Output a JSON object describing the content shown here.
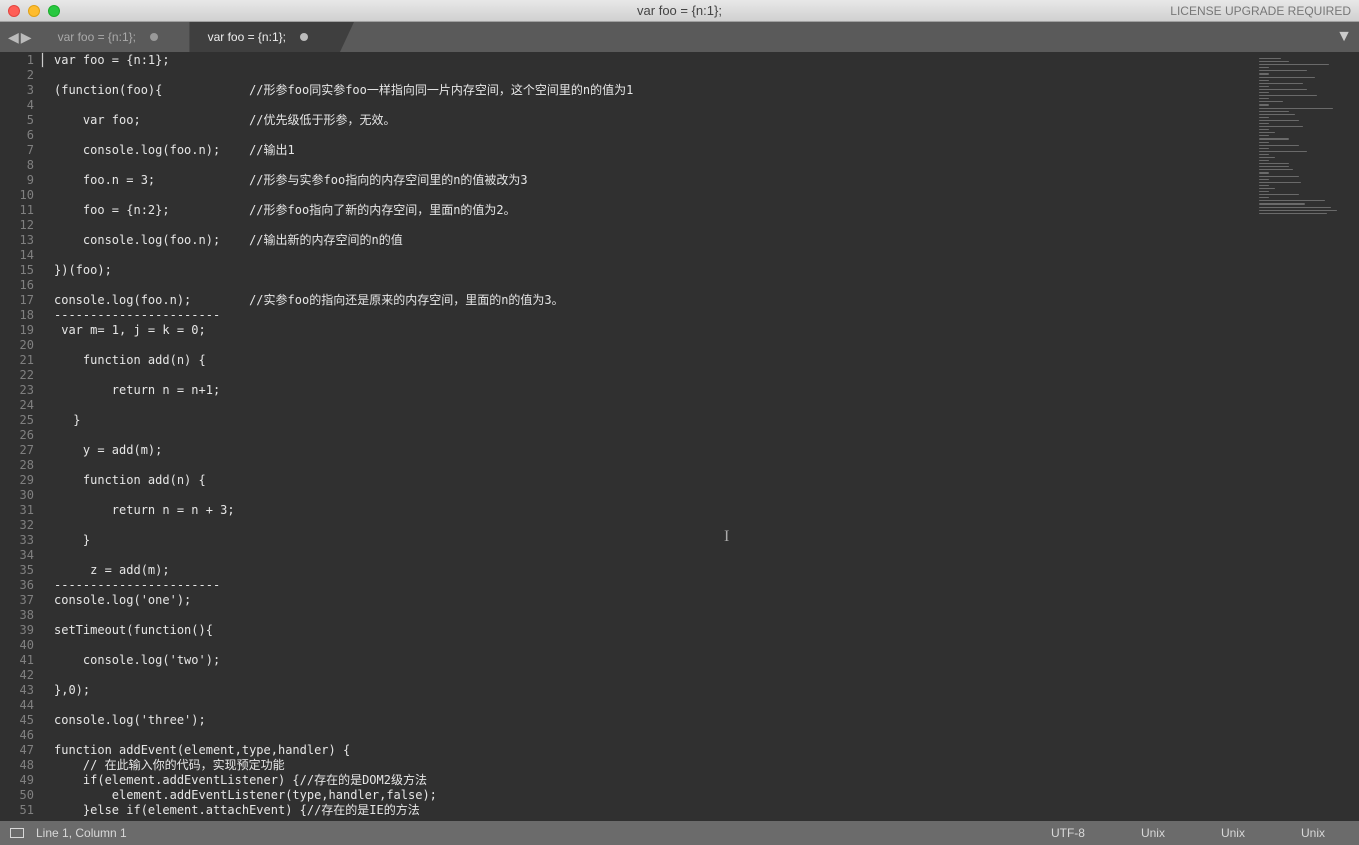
{
  "window": {
    "title": "var foo = {n:1};",
    "license_msg": "LICENSE UPGRADE REQUIRED"
  },
  "tabs": [
    {
      "label": "var foo = {n:1};",
      "active": false,
      "dirty": true
    },
    {
      "label": "var foo = {n:1};",
      "active": true,
      "dirty": true
    }
  ],
  "code_lines": [
    "var foo = {n:1};",
    "",
    "(function(foo){            //形参foo同实参foo一样指向同一片内存空间，这个空间里的n的值为1",
    "",
    "    var foo;               //优先级低于形参，无效。",
    "",
    "    console.log(foo.n);    //输出1",
    "",
    "    foo.n = 3;             //形参与实参foo指向的内存空间里的n的值被改为3",
    "",
    "    foo = {n:2};           //形参foo指向了新的内存空间，里面n的值为2。",
    "",
    "    console.log(foo.n);    //输出新的内存空间的n的值",
    "",
    "})(foo);",
    "",
    "console.log(foo.n);        //实参foo的指向还是原来的内存空间，里面的n的值为3。",
    "-----------------------",
    " var m= 1, j = k = 0;",
    "",
    "    function add(n) {",
    "",
    "        return n = n+1;",
    "",
    "　 }",
    "",
    "    y = add(m);",
    "",
    "    function add(n) {",
    "",
    "        return n = n + 3;",
    "",
    "    }",
    "",
    "     z = add(m);",
    "-----------------------",
    "console.log('one');",
    "",
    "setTimeout(function(){",
    "",
    "    console.log('two');",
    "",
    "},0);",
    "",
    "console.log('three');",
    "",
    "function addEvent(element,type,handler) {",
    "    // 在此输入你的代码，实现预定功能",
    "    if(element.addEventListener) {//存在的是DOM2级方法",
    "        element.addEventListener(type,handler,false);",
    "    }else if(element.attachEvent) {//存在的是IE的方法"
  ],
  "status": {
    "position": "Line 1, Column 1",
    "encoding": "UTF-8",
    "line_endings": "Unix",
    "extra1": "Unix",
    "extra2": "Unix"
  },
  "minimap_widths": [
    22,
    30,
    70,
    10,
    48,
    10,
    56,
    10,
    44,
    10,
    48,
    10,
    58,
    10,
    24,
    10,
    74,
    30,
    36,
    10,
    40,
    10,
    44,
    10,
    16,
    10,
    30,
    10,
    40,
    10,
    48,
    10,
    16,
    10,
    30,
    30,
    34,
    10,
    40,
    10,
    42,
    10,
    16,
    10,
    40,
    10,
    66,
    46,
    72,
    78,
    68
  ]
}
